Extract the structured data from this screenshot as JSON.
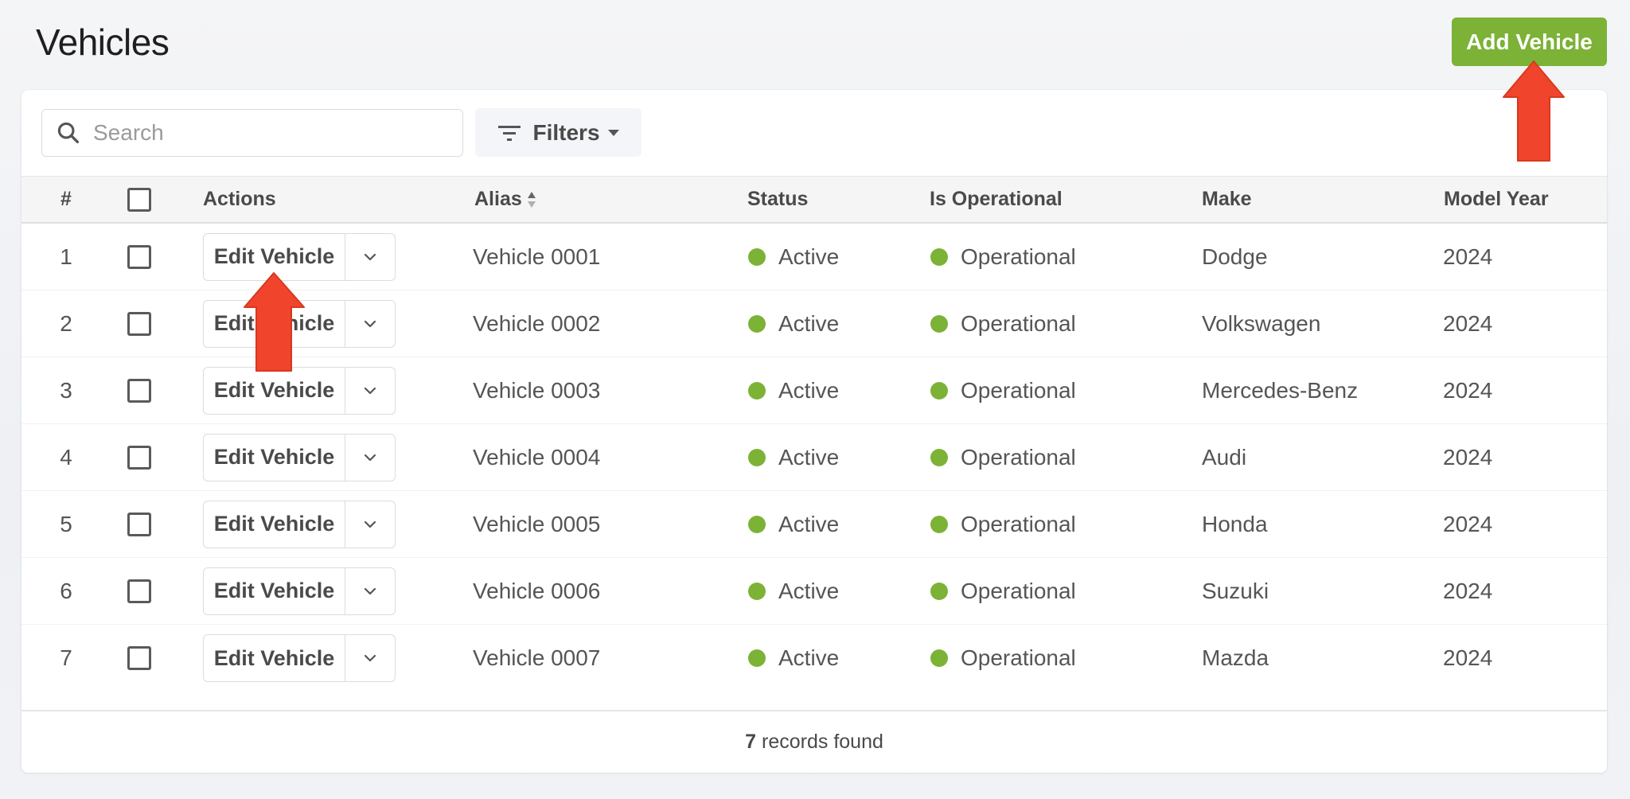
{
  "header": {
    "title": "Vehicles",
    "add_button_label": "Add Vehicle"
  },
  "toolbar": {
    "search_placeholder": "Search",
    "search_value": "",
    "filters_label": "Filters"
  },
  "table": {
    "columns": {
      "index": "#",
      "actions": "Actions",
      "alias": "Alias",
      "status": "Status",
      "is_operational": "Is Operational",
      "make": "Make",
      "model_year": "Model Year"
    },
    "sort_column": "Alias",
    "rows": [
      {
        "index": "1",
        "action_label": "Edit Vehicle",
        "alias": "Vehicle 0001",
        "status": "Active",
        "operational": "Operational",
        "make": "Dodge",
        "model_year": "2024"
      },
      {
        "index": "2",
        "action_label": "Edit Vehicle",
        "alias": "Vehicle 0002",
        "status": "Active",
        "operational": "Operational",
        "make": "Volkswagen",
        "model_year": "2024"
      },
      {
        "index": "3",
        "action_label": "Edit Vehicle",
        "alias": "Vehicle 0003",
        "status": "Active",
        "operational": "Operational",
        "make": "Mercedes-Benz",
        "model_year": "2024"
      },
      {
        "index": "4",
        "action_label": "Edit Vehicle",
        "alias": "Vehicle 0004",
        "status": "Active",
        "operational": "Operational",
        "make": "Audi",
        "model_year": "2024"
      },
      {
        "index": "5",
        "action_label": "Edit Vehicle",
        "alias": "Vehicle 0005",
        "status": "Active",
        "operational": "Operational",
        "make": "Honda",
        "model_year": "2024"
      },
      {
        "index": "6",
        "action_label": "Edit Vehicle",
        "alias": "Vehicle 0006",
        "status": "Active",
        "operational": "Operational",
        "make": "Suzuki",
        "model_year": "2024"
      },
      {
        "index": "7",
        "action_label": "Edit Vehicle",
        "alias": "Vehicle 0007",
        "status": "Active",
        "operational": "Operational",
        "make": "Mazda",
        "model_year": "2024"
      }
    ]
  },
  "footer": {
    "count": "7",
    "count_suffix": "records found"
  },
  "colors": {
    "accent_green": "#7cb236",
    "status_dot": "#7cb236",
    "annotation_arrow": "#f0452c"
  },
  "annotations": [
    {
      "type": "arrow-up",
      "points_to": "Add Vehicle"
    },
    {
      "type": "arrow-up",
      "points_to": "Edit Vehicle"
    }
  ]
}
